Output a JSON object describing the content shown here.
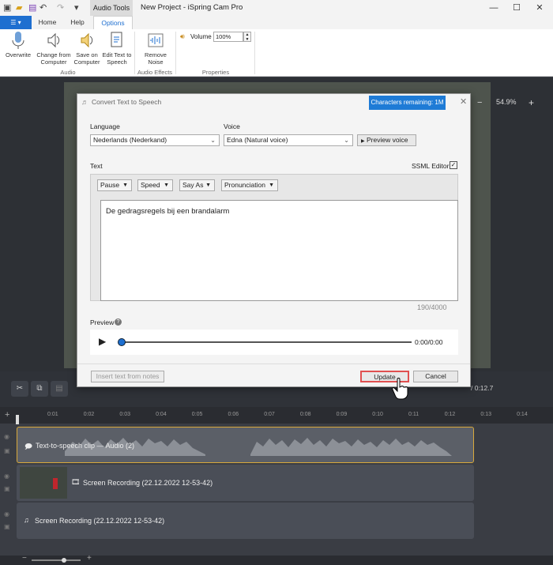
{
  "titlebar": {
    "context_tab": "Audio Tools",
    "title": "New Project - iSpring Cam Pro"
  },
  "ribbon_tabs": {
    "file": "☰ ▾",
    "home": "Home",
    "help": "Help",
    "options": "Options"
  },
  "ribbon": {
    "overwrite": "Overwrite",
    "change_from_computer": "Change from Computer",
    "save_on_computer": "Save on Computer",
    "edit_text_to_speech": "Edit Text to Speech",
    "remove_noise": "Remove Noise",
    "volume_label": "Volume",
    "volume_value": "100%",
    "group_audio": "Audio",
    "group_effects": "Audio Effects",
    "group_properties": "Properties"
  },
  "canvas": {
    "zoom": "54.9%"
  },
  "toolbar": {
    "time_total": "/ 0:12.7"
  },
  "ruler": [
    "0:01",
    "0:02",
    "0:03",
    "0:04",
    "0:05",
    "0:06",
    "0:07",
    "0:08",
    "0:09",
    "0:10",
    "0:11",
    "0:12",
    "0:13",
    "0:14"
  ],
  "tracks": [
    {
      "label": "Text-to-speech clip — Audio (2)"
    },
    {
      "label": "Screen Recording (22.12.2022 12-53-42)"
    },
    {
      "label": "Screen Recording (22.12.2022 12-53-42)"
    }
  ],
  "dialog": {
    "title": "Convert Text to Speech",
    "chars_remaining": "Characters remaining: 1M",
    "language_label": "Language",
    "language_value": "Nederlands (Nederkand)",
    "voice_label": "Voice",
    "voice_value": "Edna (Natural voice)",
    "preview_voice": "Preview voice",
    "text_label": "Text",
    "ssml_label": "SSML Editor",
    "pause": "Pause",
    "speed": "Speed",
    "say_as": "Say As",
    "pronunciation": "Pronunciation",
    "text_value": "De gedragsregels bij een brandalarm",
    "counter": "190/4000",
    "preview_label": "Preview",
    "player_time": "0:00/0:00",
    "insert_notes": "Insert text from notes",
    "update": "Update",
    "cancel": "Cancel"
  },
  "colors": {
    "accent": "#1e6fd0",
    "track_highlight": "#d8a93b",
    "update_outline": "#e05050"
  }
}
